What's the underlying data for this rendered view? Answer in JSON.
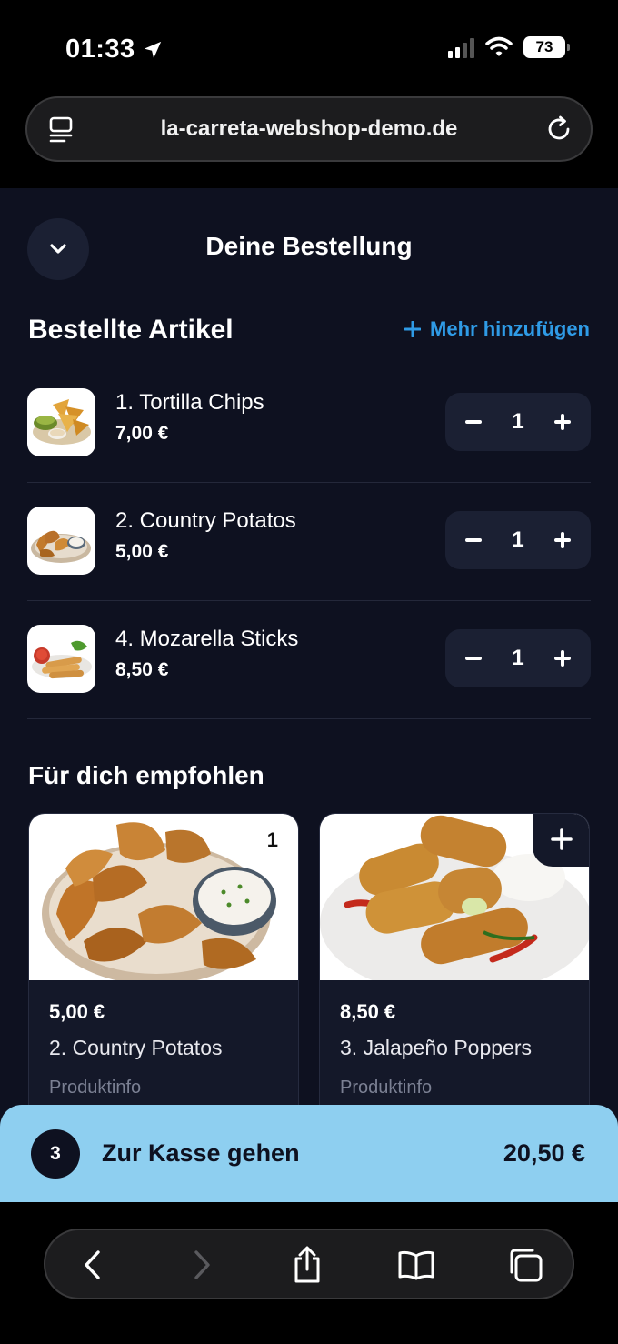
{
  "status_bar": {
    "time": "01:33",
    "battery": "73"
  },
  "browser": {
    "url": "la-carreta-webshop-demo.de"
  },
  "header": {
    "title": "Deine Bestellung"
  },
  "ordered": {
    "title": "Bestellte Artikel",
    "add_more": "Mehr hinzufügen",
    "items": [
      {
        "name": "1. Tortilla Chips",
        "price": "7,00 €",
        "quantity": "1"
      },
      {
        "name": "2. Country Potatos",
        "price": "5,00 €",
        "quantity": "1"
      },
      {
        "name": "4. Mozarella Sticks",
        "price": "8,50 €",
        "quantity": "1"
      }
    ]
  },
  "recommended": {
    "title": "Für dich empfohlen",
    "cards": [
      {
        "price": "5,00 €",
        "name": "2. Country Potatos",
        "info": "Produktinfo",
        "count": "1"
      },
      {
        "price": "8,50 €",
        "name": "3. Jalapeño Poppers",
        "info": "Produktinfo"
      }
    ]
  },
  "checkout": {
    "count": "3",
    "label": "Zur Kasse gehen",
    "total": "20,50 €"
  },
  "colors": {
    "app_background": "#0e1120",
    "accent_link": "#2f9be6",
    "checkout_bar": "#8ecff0"
  }
}
